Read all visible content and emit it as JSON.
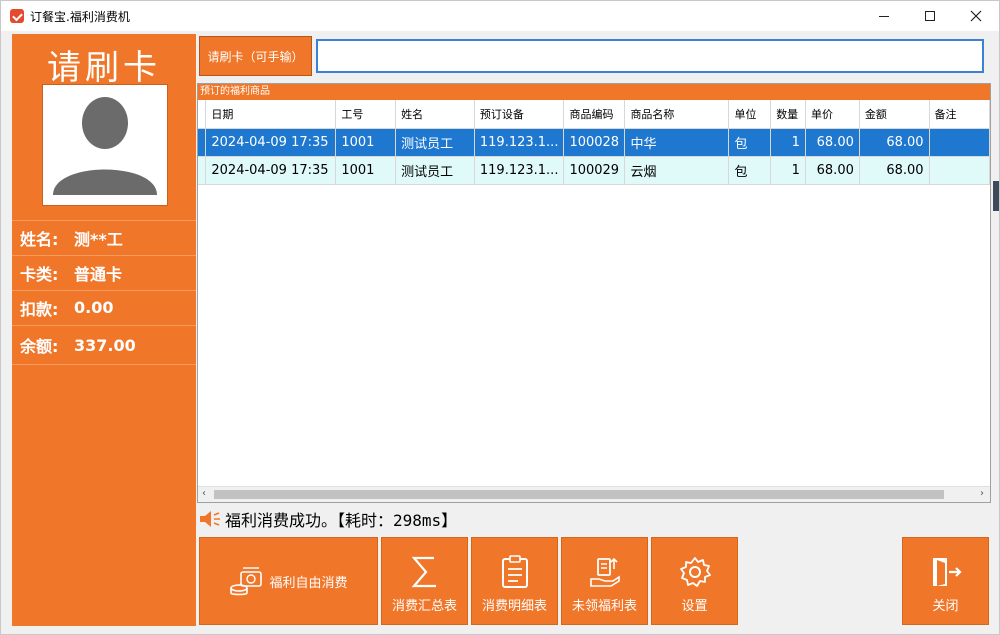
{
  "window": {
    "title": "订餐宝.福利消费机",
    "controls": {
      "minimize": "minimize-icon",
      "maximize": "maximize-icon",
      "close": "close-icon"
    }
  },
  "left": {
    "heading": "请刷卡",
    "info": [
      {
        "label": "姓名:",
        "value": "测**工"
      },
      {
        "label": "卡类:",
        "value": "普通卡"
      },
      {
        "label": "扣款:",
        "value": "0.00"
      },
      {
        "label": "余额:",
        "value": "337.00"
      }
    ]
  },
  "card": {
    "button_label": "请刷卡（可手输）",
    "input_value": ""
  },
  "grid": {
    "caption": "预订的福利商品",
    "columns": [
      "日期",
      "工号",
      "姓名",
      "预订设备",
      "商品编码",
      "商品名称",
      "单位",
      "数量",
      "单价",
      "金额",
      "备注"
    ],
    "rows": [
      {
        "date": "2024-04-09 17:35",
        "emp_no": "1001",
        "name": "测试员工",
        "device": "119.123.1...",
        "code": "100028",
        "product": "中华",
        "unit": "包",
        "qty": "1",
        "price": "68.00",
        "amount": "68.00",
        "note": ""
      },
      {
        "date": "2024-04-09 17:35",
        "emp_no": "1001",
        "name": "测试员工",
        "device": "119.123.1...",
        "code": "100029",
        "product": "云烟",
        "unit": "包",
        "qty": "1",
        "price": "68.00",
        "amount": "68.00",
        "note": ""
      }
    ]
  },
  "status": {
    "message": "福利消费成功。【耗时：298ms】"
  },
  "buttons": {
    "free_consume": "福利自由消费",
    "summary": "消费汇总表",
    "detail": "消费明细表",
    "unclaimed": "未领福利表",
    "settings": "设置",
    "close": "关闭"
  },
  "colors": {
    "accent": "#f0772a",
    "selection": "#1e78d0",
    "alt_row": "#e0fafa"
  }
}
